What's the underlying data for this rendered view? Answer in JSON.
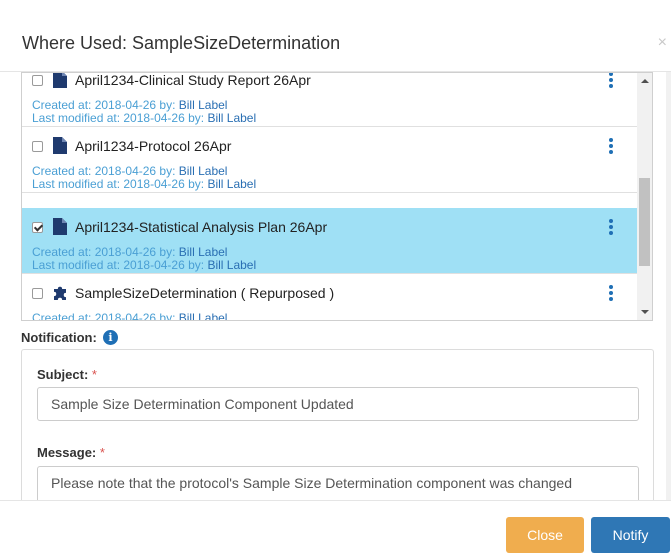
{
  "dialog": {
    "title": "Where Used: SampleSizeDetermination",
    "close_glyph": "×"
  },
  "documents": [
    {
      "title": "April1234-Clinical Study Report 26Apr",
      "icon": "document-icon",
      "checked": false,
      "selected": false,
      "created_prefix": "Created at: 2018-04-26 by: ",
      "created_by": "Bill Label",
      "modified_prefix": "Last modified at: 2018-04-26 by: ",
      "modified_by": "Bill Label"
    },
    {
      "title": "April1234-Protocol 26Apr",
      "icon": "document-icon",
      "checked": false,
      "selected": false,
      "created_prefix": "Created at: 2018-04-26 by: ",
      "created_by": "Bill Label",
      "modified_prefix": "Last modified at: 2018-04-26 by: ",
      "modified_by": "Bill Label"
    },
    {
      "title": "April1234-Statistical Analysis Plan 26Apr",
      "icon": "document-icon",
      "checked": true,
      "selected": true,
      "created_prefix": "Created at: 2018-04-26 by: ",
      "created_by": "Bill Label",
      "modified_prefix": "Last modified at: 2018-04-26 by: ",
      "modified_by": "Bill Label"
    },
    {
      "title": "SampleSizeDetermination ( Repurposed )",
      "icon": "puzzle-piece-icon",
      "checked": false,
      "selected": false,
      "created_prefix": "Created at: 2018-04-26 by: ",
      "created_by": "Bill Label",
      "modified_prefix": "",
      "modified_by": ""
    }
  ],
  "notification": {
    "label": "Notification:",
    "subject_label": "Subject:",
    "subject_value": "Sample Size Determination Component Updated",
    "message_label": "Message:",
    "message_value": "Please note that the protocol's Sample Size Determination component was changed",
    "required_marker": "*"
  },
  "footer": {
    "close_label": "Close",
    "notify_label": "Notify"
  },
  "colors": {
    "selected_row": "#9fe0f5",
    "link": "#4a9fd4",
    "icon_blue": "#1f3a6e",
    "close_button": "#f0ad4e",
    "notify_button": "#2f77b5"
  }
}
